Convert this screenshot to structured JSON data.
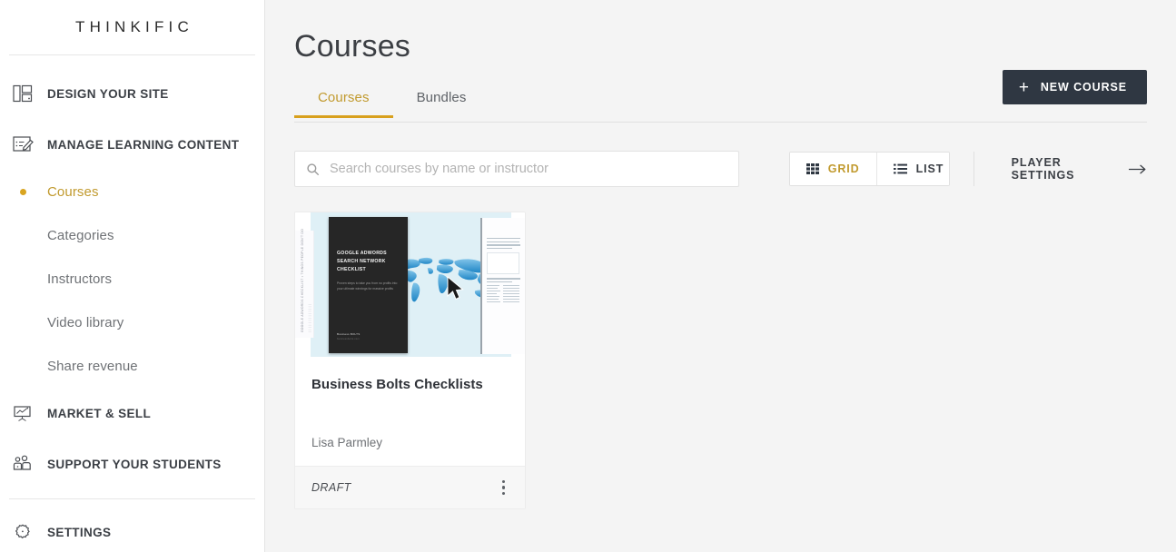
{
  "brand": {
    "logo_text": "THINKIFIC",
    "accent_gold": "#c19a2e",
    "accent_underline": "#d8a01d",
    "dark_button": "#2f3742"
  },
  "sidebar": {
    "sections": [
      {
        "label": "DESIGN YOUR SITE",
        "icon": "layout-panels-icon"
      },
      {
        "label": "MANAGE LEARNING CONTENT",
        "icon": "edit-pencil-icon"
      },
      {
        "label": "MARKET & SELL",
        "icon": "presentation-chart-icon"
      },
      {
        "label": "SUPPORT YOUR STUDENTS",
        "icon": "people-icon"
      },
      {
        "label": "SETTINGS",
        "icon": "gear-icon"
      }
    ],
    "sub_items": [
      {
        "label": "Courses",
        "active": true
      },
      {
        "label": "Categories",
        "active": false
      },
      {
        "label": "Instructors",
        "active": false
      },
      {
        "label": "Video library",
        "active": false
      },
      {
        "label": "Share revenue",
        "active": false
      }
    ]
  },
  "header": {
    "title": "Courses",
    "tabs": [
      {
        "label": "Courses",
        "active": true
      },
      {
        "label": "Bundles",
        "active": false
      }
    ],
    "new_course_label": "NEW COURSE",
    "new_course_icon": "plus-icon"
  },
  "controls": {
    "search_placeholder": "Search courses by name or instructor",
    "search_value": "",
    "search_icon": "search-icon",
    "view_modes": [
      {
        "label": "GRID",
        "icon": "grid-icon",
        "active": true
      },
      {
        "label": "LIST",
        "icon": "list-icon",
        "active": false
      }
    ],
    "player_settings_label": "PLAYER SETTINGS",
    "player_settings_icon": "arrow-right-icon"
  },
  "courses": [
    {
      "title": "Business Bolts Checklists",
      "author": "Lisa Parmley",
      "status": "DRAFT",
      "menu_icon": "kebab-menu-icon",
      "thumbnail": {
        "cover_title": "GOOGLE ADWORDS SEARCH NETWORK CHECKLIST",
        "cover_subtitle": "Proven steps to take you from no profits into your ultimate winnings for massive profits",
        "cover_logo": "Business BOLTS",
        "cover_logo_sub": "businessbolts.com",
        "left_doc_text": "GOOGLE ADWORDS CHECKLIST • THINGS PEOPLE DON'T DO",
        "alt": "Google AdWords Search Network Checklist cover with world map"
      }
    }
  ]
}
